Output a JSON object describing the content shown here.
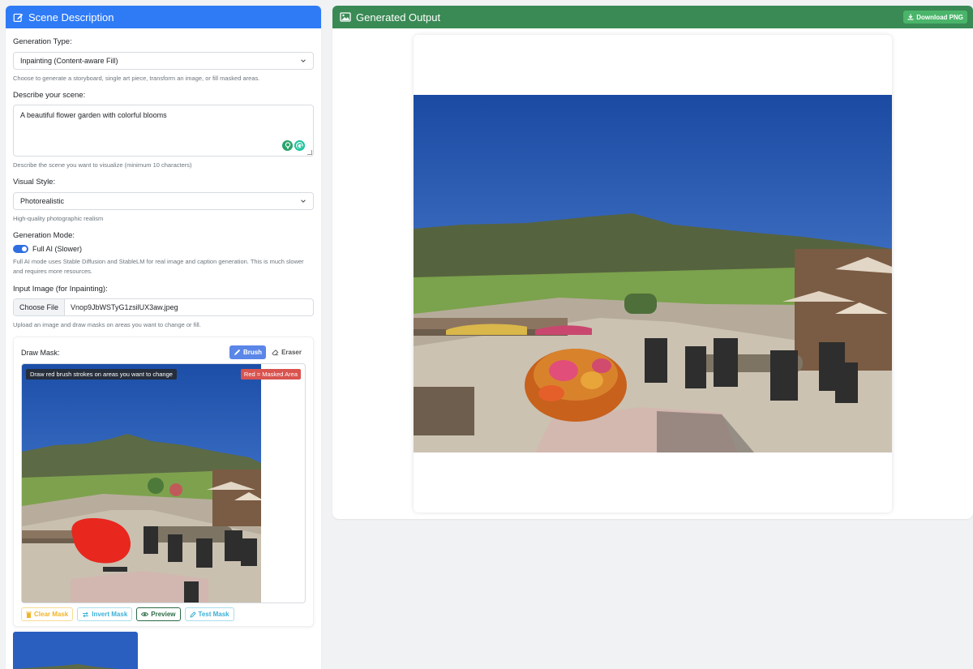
{
  "left": {
    "title": "Scene Description",
    "generation_type": {
      "label": "Generation Type:",
      "value": "Inpainting (Content-aware Fill)",
      "help": "Choose to generate a storyboard, single art piece, transform an image, or fill masked areas."
    },
    "scene": {
      "label": "Describe your scene:",
      "value": "A beautiful flower garden with colorful blooms",
      "help": "Describe the scene you want to visualize (minimum 10 characters)"
    },
    "visual_style": {
      "label": "Visual Style:",
      "value": "Photorealistic",
      "help": "High-quality photographic realism"
    },
    "generation_mode": {
      "label": "Generation Mode:",
      "toggle_label": "Full AI (Slower)",
      "enabled": true,
      "help": "Full AI mode uses Stable Diffusion and StableLM for real image and caption generation. This is much slower and requires more resources."
    },
    "input_image": {
      "label": "Input Image (for Inpainting):",
      "button": "Choose File",
      "filename": "Vnop9JbWSTyG1zsilUX3aw.jpeg",
      "help": "Upload an image and draw masks on areas you want to change or fill."
    },
    "mask": {
      "title": "Draw Mask:",
      "brush": "Brush",
      "eraser": "Eraser",
      "instruction": "Draw red brush strokes on areas you want to change",
      "legend": "Red = Masked Area",
      "clear": "Clear Mask",
      "invert": "Invert Mask",
      "preview": "Preview",
      "test": "Test Mask"
    }
  },
  "right": {
    "title": "Generated Output",
    "download": "Download PNG"
  },
  "colors": {
    "left_header": "#2f7bf6",
    "right_header": "#3a8a55",
    "mask_red": "#e8271e"
  }
}
